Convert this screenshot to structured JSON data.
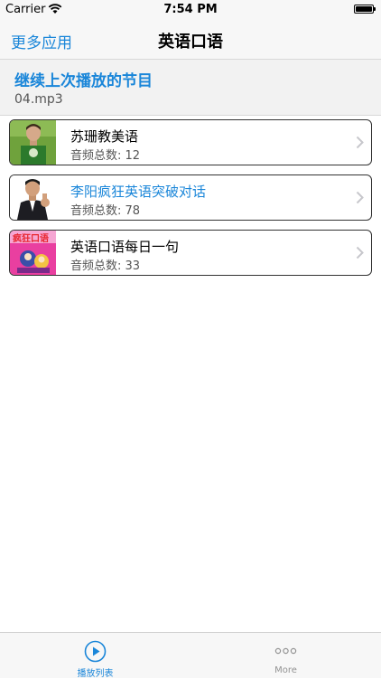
{
  "status_bar": {
    "carrier": "Carrier",
    "time": "7:54 PM"
  },
  "nav": {
    "left_button": "更多应用",
    "title": "英语口语"
  },
  "resume": {
    "title": "继续上次播放的节目",
    "file": "04.mp3",
    "play_icon": "play-circle-icon"
  },
  "list": [
    {
      "name": "苏珊教美语",
      "count_label": "音频总数: 12",
      "active": false
    },
    {
      "name": "李阳疯狂英语突破对话",
      "count_label": "音频总数: 78",
      "active": true
    },
    {
      "name": "英语口语每日一句",
      "count_label": "音频总数: 33",
      "active": false
    }
  ],
  "thumb_text": {
    "item3": "疯狂口语"
  },
  "tabs": [
    {
      "label": "播放列表",
      "icon": "play-circle-icon",
      "selected": true
    },
    {
      "label": "More",
      "icon": "more-dots-icon",
      "selected": false
    }
  ],
  "colors": {
    "accent": "#1a86d9",
    "card_border": "#333333",
    "tab_inactive": "#929292"
  }
}
